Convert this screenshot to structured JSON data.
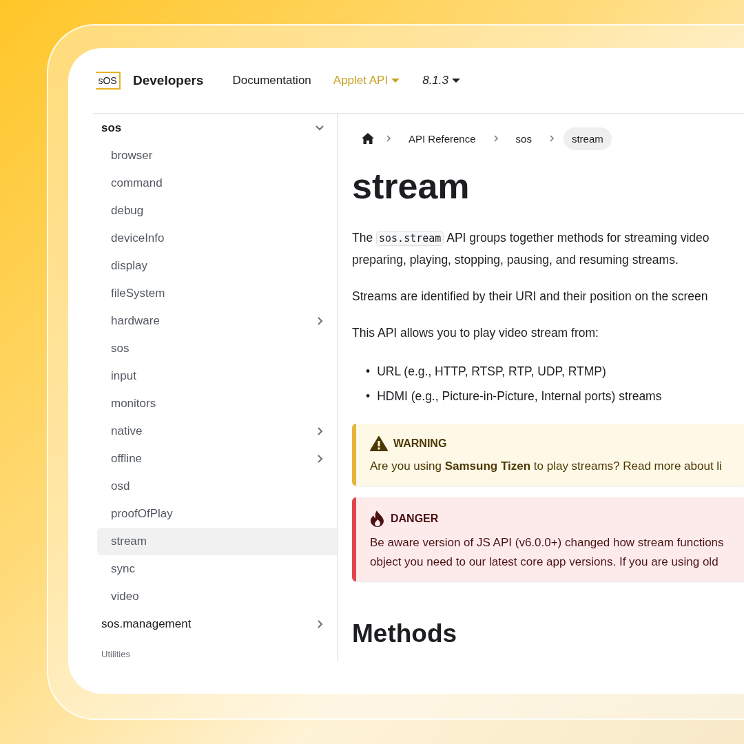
{
  "header": {
    "logo": "sOS",
    "brand": "Developers",
    "nav": [
      {
        "label": "Documentation",
        "selected": false,
        "dropdown": false
      },
      {
        "label": "Applet API",
        "selected": true,
        "dropdown": true
      },
      {
        "label": "8.1.3",
        "selected": false,
        "dropdown": true,
        "kind": "version"
      }
    ]
  },
  "sidebar": {
    "items": [
      {
        "label": "sos",
        "expanded": true,
        "children": [
          {
            "label": "browser",
            "selected": false
          },
          {
            "label": "command",
            "selected": false
          },
          {
            "label": "debug",
            "selected": false
          },
          {
            "label": "deviceInfo",
            "selected": false
          },
          {
            "label": "display",
            "selected": false
          },
          {
            "label": "fileSystem",
            "selected": false
          },
          {
            "label": "hardware",
            "selected": false,
            "expanded": false
          },
          {
            "label": "sos",
            "selected": false
          },
          {
            "label": "input",
            "selected": false
          },
          {
            "label": "monitors",
            "selected": false
          },
          {
            "label": "native",
            "selected": false,
            "expanded": false
          },
          {
            "label": "offline",
            "selected": false,
            "expanded": false
          },
          {
            "label": "osd",
            "selected": false
          },
          {
            "label": "proofOfPlay",
            "selected": false
          },
          {
            "label": "stream",
            "selected": true
          },
          {
            "label": "sync",
            "selected": false
          },
          {
            "label": "video",
            "selected": false
          }
        ]
      },
      {
        "label": "sos.management",
        "expanded": false
      }
    ],
    "section_label": "Utilities"
  },
  "breadcrumbs": [
    {
      "label": "API Reference",
      "selected": false
    },
    {
      "label": "sos",
      "selected": false
    },
    {
      "label": "stream",
      "selected": true
    }
  ],
  "title": "stream",
  "intro": {
    "before": "The",
    "code": "sos.stream",
    "after": "API groups together methods for streaming video",
    "line2": "preparing, playing, stopping, pausing, and resuming streams."
  },
  "paragraphs": [
    "Streams are identified by their URI and their position on the screen",
    "This API allows you to play video stream from:"
  ],
  "bullets": [
    {
      "marker": "•",
      "text": "URL (e.g., HTTP, RTSP, RTP, UDP, RTMP)"
    },
    {
      "marker": "•",
      "text": "HDMI (e.g., Picture-in-Picture, Internal ports) streams"
    }
  ],
  "callouts": [
    {
      "kind": "warning",
      "heading": "WARNING",
      "lines": [
        "Are you using **Samsung Tizen** to play streams? Read more about li"
      ]
    },
    {
      "kind": "danger",
      "heading": "DANGER",
      "lines": [
        "Be aware version of JS API (v6.0.0+) changed how stream functions",
        "object you need to our latest core app versions. If you are using old"
      ]
    }
  ],
  "methods_heading": "Methods"
}
